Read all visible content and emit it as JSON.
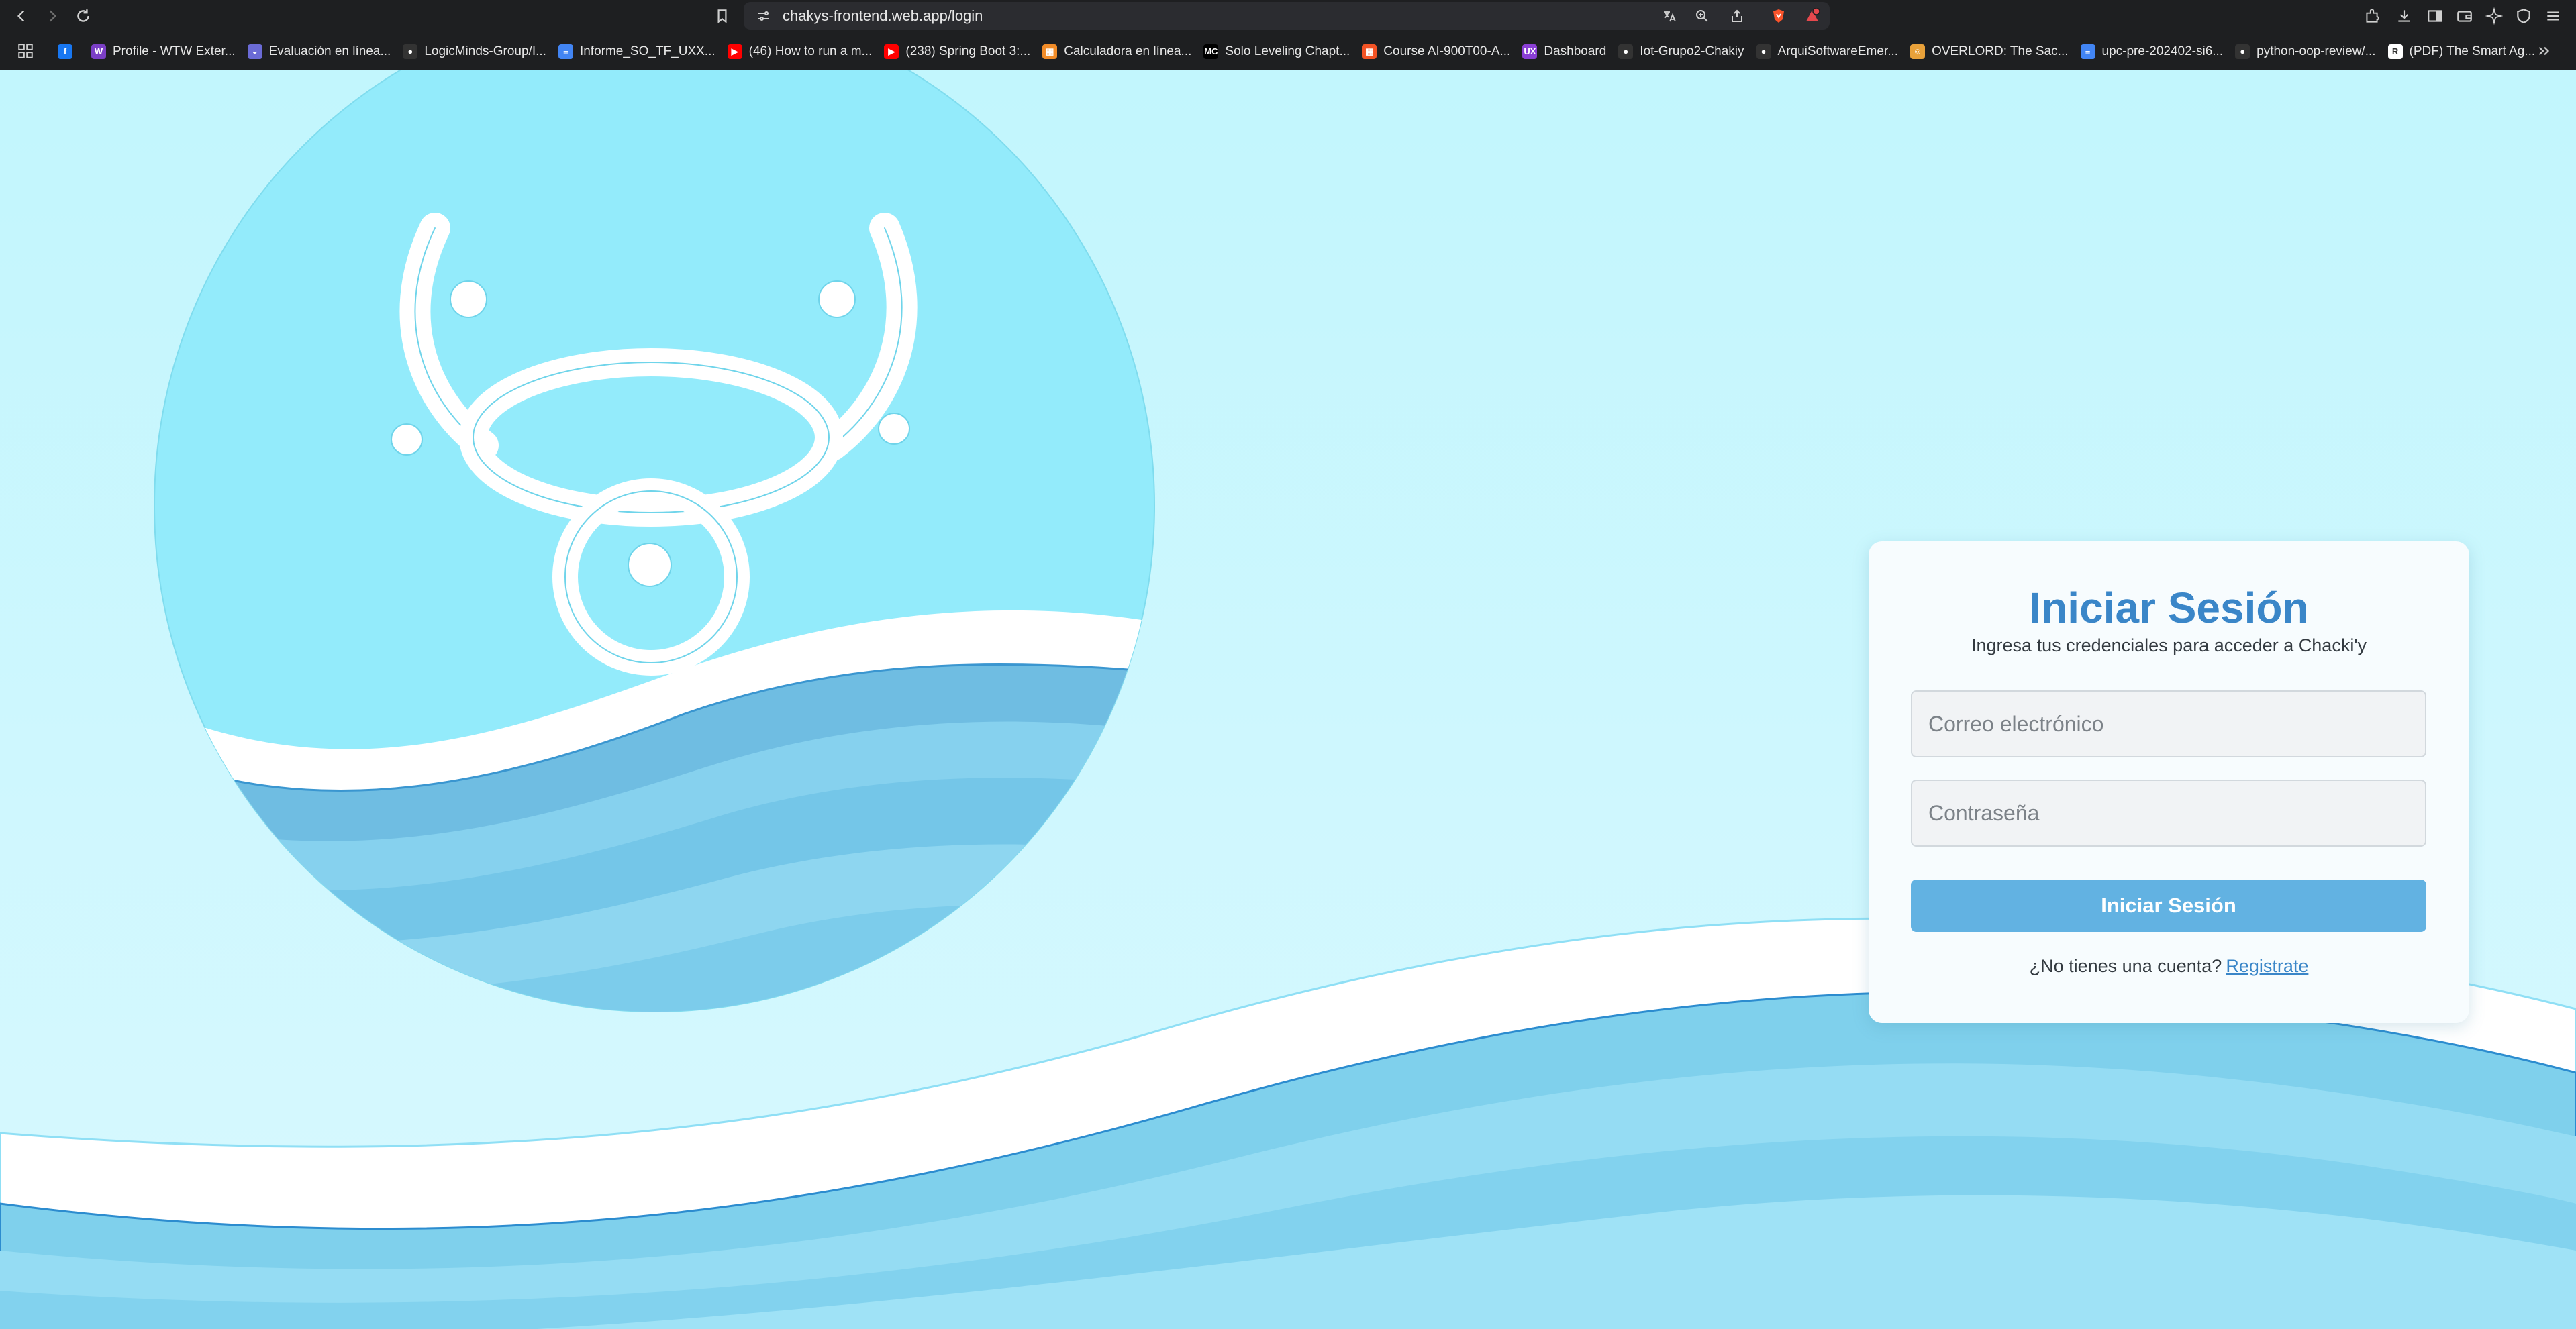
{
  "browser": {
    "url": "chakys-frontend.web.app/login",
    "notification_count": "1"
  },
  "bookmarks": [
    {
      "label": "",
      "icon": "facebook-icon",
      "color": "#1877f2",
      "glyph": "f"
    },
    {
      "label": "Profile - WTW Exter...",
      "icon": "wtw-icon",
      "color": "#7b3fc6",
      "glyph": "W"
    },
    {
      "label": "Evaluación en línea...",
      "icon": "evaluation-icon",
      "color": "#6b6bd6",
      "glyph": "◒"
    },
    {
      "label": "LogicMinds-Group/I...",
      "icon": "github-icon",
      "color": "#333333",
      "glyph": "●"
    },
    {
      "label": "Informe_SO_TF_UXX...",
      "icon": "docs-icon",
      "color": "#4285f4",
      "glyph": "≡"
    },
    {
      "label": "(46) How to run a m...",
      "icon": "youtube-icon",
      "color": "#ff0000",
      "glyph": "▶"
    },
    {
      "label": "(238) Spring Boot 3:...",
      "icon": "youtube-icon",
      "color": "#ff0000",
      "glyph": "▶"
    },
    {
      "label": "Calculadora en línea...",
      "icon": "calculator-icon",
      "color": "#f28c28",
      "glyph": "▦"
    },
    {
      "label": "Solo Leveling Chapt...",
      "icon": "manga-icon",
      "color": "#000000",
      "glyph": "MC"
    },
    {
      "label": "Course AI-900T00-A...",
      "icon": "microsoft-icon",
      "color": "#f35325",
      "glyph": "▦"
    },
    {
      "label": "Dashboard",
      "icon": "dashboard-icon",
      "color": "#8b3fd6",
      "glyph": "UX"
    },
    {
      "label": "Iot-Grupo2-Chakiy",
      "icon": "github-icon",
      "color": "#333333",
      "glyph": "●"
    },
    {
      "label": "ArquiSoftwareEmer...",
      "icon": "github-icon",
      "color": "#333333",
      "glyph": "●"
    },
    {
      "label": "OVERLORD: The Sac...",
      "icon": "overlord-icon",
      "color": "#e8a13a",
      "glyph": "☺"
    },
    {
      "label": "upc-pre-202402-si6...",
      "icon": "docs-icon",
      "color": "#4285f4",
      "glyph": "≡"
    },
    {
      "label": "python-oop-review/...",
      "icon": "github-icon",
      "color": "#333333",
      "glyph": "●"
    },
    {
      "label": "(PDF) The Smart Ag...",
      "icon": "researchgate-icon",
      "color": "#ffffff",
      "glyph": "R"
    }
  ],
  "login": {
    "title": "Iniciar Sesión",
    "subtitle": "Ingresa tus credenciales para acceder a Chacki'y",
    "email_placeholder": "Correo electrónico",
    "password_placeholder": "Contraseña",
    "submit_label": "Iniciar Sesión",
    "no_account_text": "¿No tienes una cuenta?",
    "register_link": "Registrate"
  },
  "colors": {
    "page_bg": "#c4f6fd",
    "brand_blue": "#3a86c8",
    "button_blue": "#62b2e2",
    "logo_circle": "#93ebfb"
  }
}
